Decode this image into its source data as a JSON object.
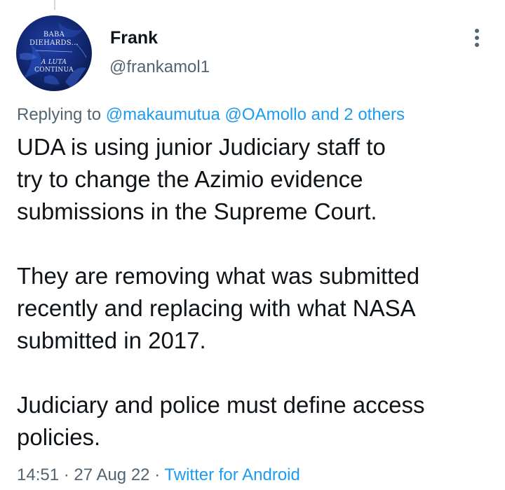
{
  "avatar": {
    "line1": "BABA",
    "line2": "DIEHARDS...",
    "line3": "A LUTA",
    "line4": "CONTINUA"
  },
  "author": {
    "name": "Frank",
    "handle": "@frankamol1"
  },
  "more_icon": "more-vertical-icon",
  "reply": {
    "prefix": "Replying to",
    "mention1": "@makaumutua",
    "mention2": "@OAmollo",
    "and_others": "and 2 others"
  },
  "tweet": {
    "line1": "UDA is using junior Judiciary staff to",
    "line2": "try to change the Azimio evidence",
    "line3": "submissions in the Supreme Court.",
    "line4": "They are removing what was submitted",
    "line5": "recently and replacing with what NASA",
    "line6": "submitted in 2017.",
    "line7": "Judiciary and police must define access",
    "line8": "policies."
  },
  "meta": {
    "time": "14:51",
    "sep1": "·",
    "date": "27 Aug 22",
    "sep2": "·",
    "source": "Twitter for Android"
  },
  "colors": {
    "link": "#1d9bf0",
    "secondary_text": "#536471",
    "primary_text": "#0f1419"
  }
}
